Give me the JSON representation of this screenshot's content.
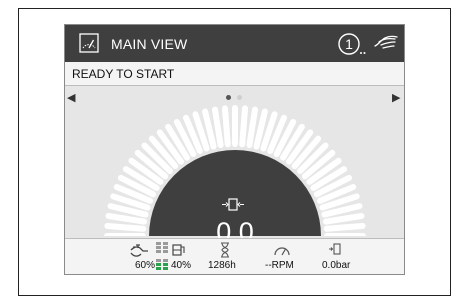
{
  "title_bar": {
    "title": "MAIN VIEW",
    "notification_count": "1"
  },
  "status_bar": {
    "text": "READY TO START"
  },
  "carousel": {
    "pages": 2,
    "active_page": 1
  },
  "gauge": {
    "value": "0.0",
    "level": 0.0
  },
  "bottom_bar": {
    "fuel_percent": "60%",
    "def_percent": "40%",
    "hours": "1286h",
    "rpm": "--RPM",
    "pressure": "0.0bar"
  },
  "colors": {
    "title_bg": "#3f3f3f",
    "screen_bg": "#e6e6e6",
    "gauge_segment": "#ffffff",
    "gauge_center": "#3f3f3f",
    "def_bar_color": "#2aa14b",
    "dot_active": "#555555",
    "dot_inactive": "#cfcfcf"
  },
  "icons": {
    "title": "gauge-screen-icon",
    "notification": "notification-one-icon",
    "hand": "hand-gesture-icon",
    "fuel": "fuel-pump-icon",
    "def": "def-tank-icon",
    "hours": "hourglass-icon",
    "rpm": "speedometer-icon",
    "pressure": "pressure-sensor-icon"
  }
}
